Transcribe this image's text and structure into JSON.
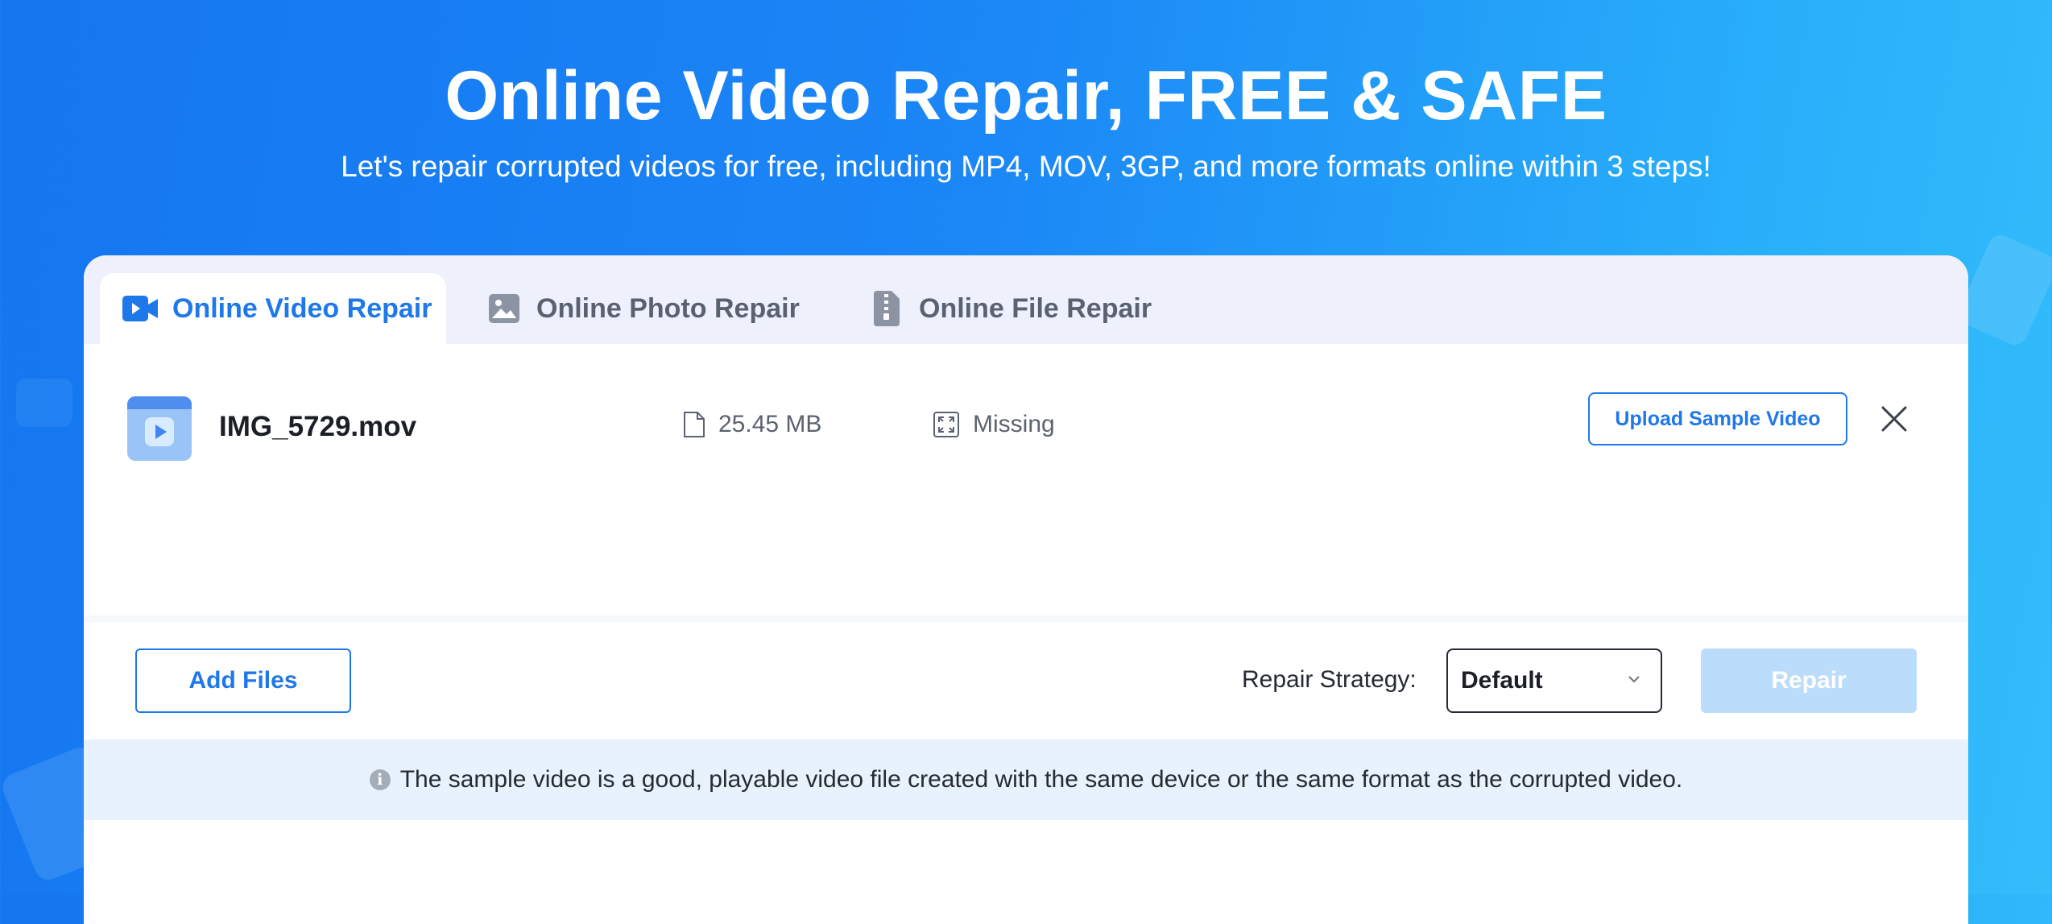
{
  "hero": {
    "title": "Online Video Repair, FREE & SAFE",
    "subtitle": "Let's repair corrupted videos for free, including MP4, MOV, 3GP, and more formats online within 3 steps!"
  },
  "tabs": [
    {
      "label": "Online Video Repair",
      "icon": "video-camera-icon",
      "active": true
    },
    {
      "label": "Online Photo Repair",
      "icon": "image-icon",
      "active": false
    },
    {
      "label": "Online File Repair",
      "icon": "zip-file-icon",
      "active": false
    }
  ],
  "file": {
    "name": "IMG_5729.mov",
    "size": "25.45 MB",
    "resolution": "Missing",
    "upload_sample_label": "Upload Sample Video"
  },
  "actions": {
    "add_files_label": "Add Files",
    "strategy_label": "Repair Strategy:",
    "strategy_value": "Default",
    "repair_label": "Repair"
  },
  "note": "The sample video is a good, playable video file created with the same device or the same format as the corrupted video.",
  "colors": {
    "accent": "#1f78ea",
    "disabled_button": "#bcdcfb",
    "note_background": "#e8f2fd"
  }
}
